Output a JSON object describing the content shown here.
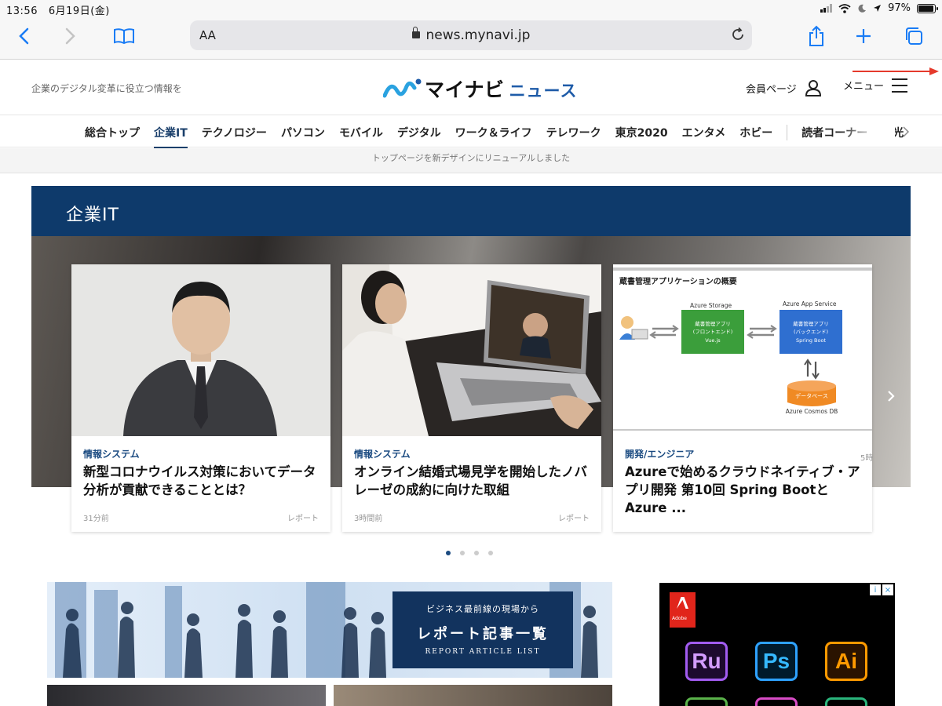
{
  "status": {
    "time": "13:56",
    "date": "6月19日(金)",
    "battery": "97%",
    "battery_level": 0.97
  },
  "browser": {
    "text_size": "AA",
    "url": "news.mynavi.jp"
  },
  "header": {
    "tagline": "企業のデジタル変革に役立つ情報を",
    "logo_main": "マイナビ",
    "logo_sub": "ニュース",
    "member_label": "会員ページ",
    "menu_label": "メニュー"
  },
  "nav": {
    "items": [
      "総合トップ",
      "企業IT",
      "テクノロジー",
      "パソコン",
      "モバイル",
      "デジタル",
      "ワーク＆ライフ",
      "テレワーク",
      "東京2020",
      "エンタメ",
      "ホビー",
      "読者コーナー",
      "久光"
    ],
    "active": "企業IT"
  },
  "notice": {
    "text": "トップページを新デザインにリニューアルしました"
  },
  "section": {
    "title": "企業IT"
  },
  "cards": [
    {
      "category": "情報システム",
      "title": "新型コロナウイルス対策においてデータ分析が貢献できることとは？",
      "time": "31分前",
      "type": "レポート"
    },
    {
      "category": "情報システム",
      "title": "オンライン結婚式場見学を開始したノバレーゼの成約に向けた取組",
      "time": "3時間前",
      "type": "レポート"
    },
    {
      "category": "開発/エンジニア",
      "title": "Azureで始めるクラウドネイティブ・アプリ開発 第10回 Spring BootとAzure ...",
      "time": "",
      "type": ""
    }
  ],
  "peek_time": "5時",
  "diagram": {
    "title": "蔵書管理アプリケーションの概要",
    "storage": "Azure Storage",
    "app_service": "Azure App Service",
    "front": "蔵書管理アプリ\n(フロントエンド)\nVue.js",
    "back": "蔵書管理アプリ\n(バックエンド)\nSpring Boot",
    "db": "データベース",
    "cosmos": "Azure Cosmos DB"
  },
  "carousel": {
    "page_count": 4,
    "current": 1
  },
  "banner": {
    "line1": "ビジネス最前線の現場から",
    "line2": "レポート記事一覧",
    "line3": "REPORT ARTICLE LIST"
  },
  "ad": {
    "brand": "Adobe",
    "apps": [
      "Ru",
      "Ps",
      "Ai"
    ]
  },
  "colors": {
    "navy": "#0e3a6b",
    "link": "#1a4a80",
    "accent_red": "#e53a2c",
    "safari_blue": "#1a7cf5"
  }
}
